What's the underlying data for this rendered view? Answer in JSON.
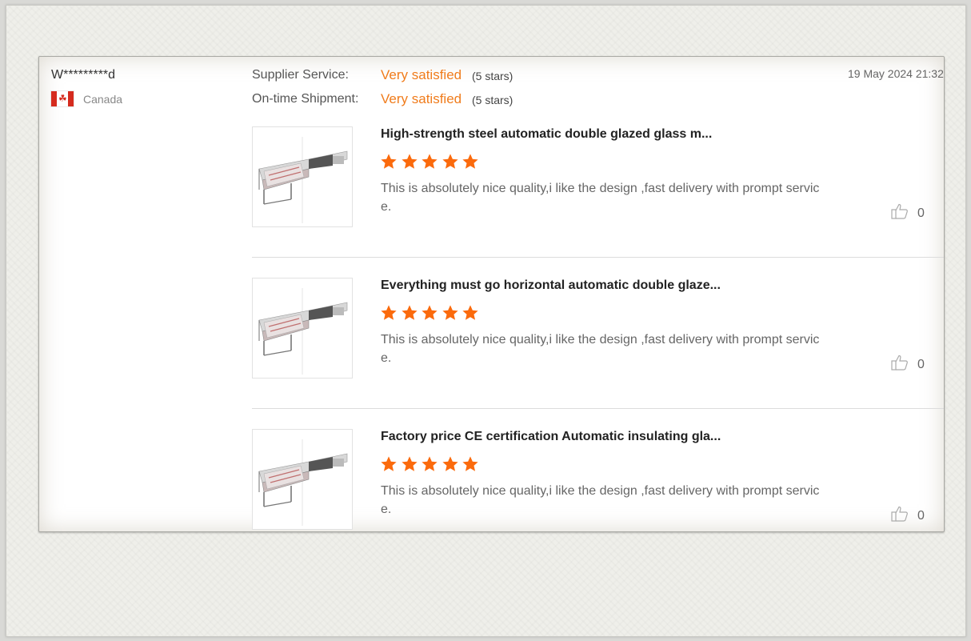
{
  "reviewer": {
    "name": "W*********d",
    "country": "Canada",
    "flag_icon": "canada-flag-icon"
  },
  "ratings": [
    {
      "label": "Supplier Service:",
      "value": "Very satisfied",
      "stars": "(5 stars)"
    },
    {
      "label": "On-time Shipment:",
      "value": "Very satisfied",
      "stars": "(5 stars)"
    }
  ],
  "date": "19 May 2024 21:32",
  "colors": {
    "accent": "#f07c1c",
    "star": "#fb6a0c"
  },
  "reviews": [
    {
      "title": "High-strength steel automatic double glazed glass m...",
      "rating": 5,
      "text": "This is absolutely nice quality,i like the design ,fast delivery with prompt service.",
      "likes": "0"
    },
    {
      "title": "Everything must go horizontal automatic double glaze...",
      "rating": 5,
      "text": "This is absolutely nice quality,i like the design ,fast delivery with prompt service.",
      "likes": "0"
    },
    {
      "title": "Factory price CE certification Automatic insulating gla...",
      "rating": 5,
      "text": "This is absolutely nice quality,i like the design ,fast delivery with prompt service.",
      "likes": "0"
    }
  ]
}
